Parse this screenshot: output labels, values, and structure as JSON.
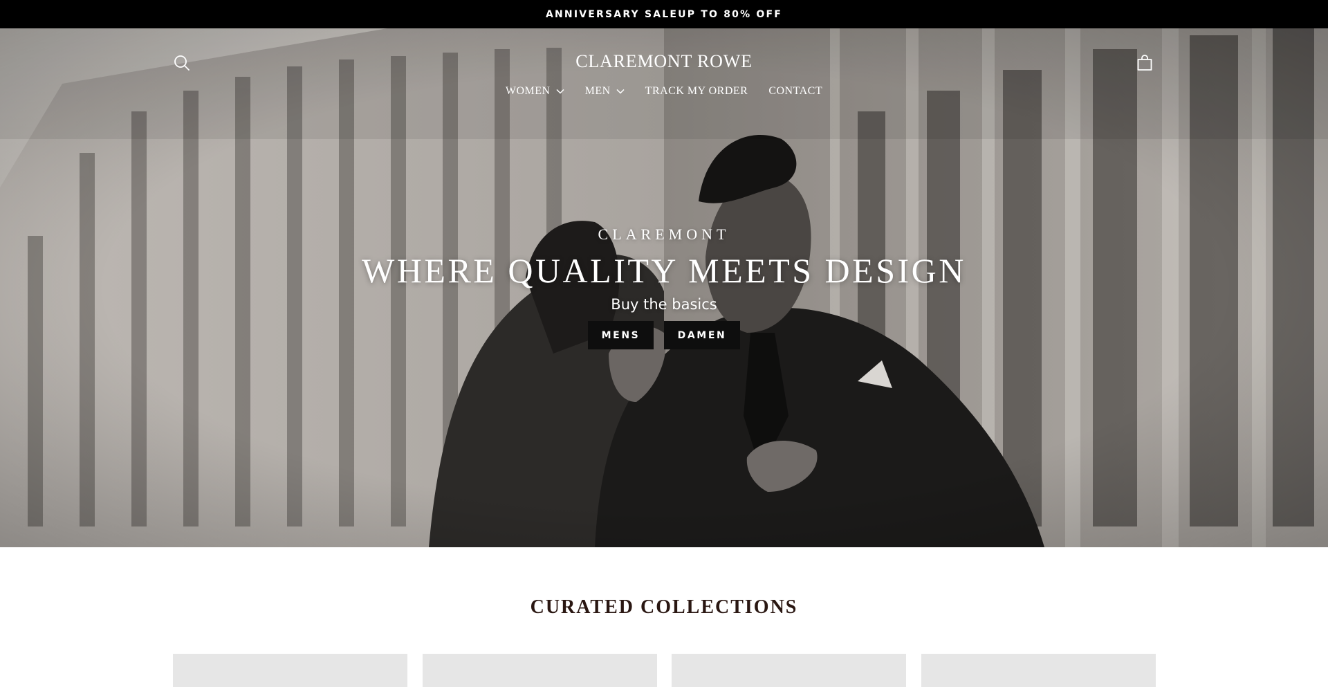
{
  "announcement": {
    "text": "ANNIVERSARY SALEUP TO 80% OFF"
  },
  "header": {
    "logo": "CLAREMONT ROWE",
    "search_icon": "search-icon",
    "cart_icon": "shopping-bag-icon",
    "nav": [
      {
        "label": "WOMEN",
        "has_dropdown": true,
        "icon": "chevron-down-icon"
      },
      {
        "label": "MEN",
        "has_dropdown": true,
        "icon": "chevron-down-icon"
      },
      {
        "label": "TRACK MY ORDER",
        "has_dropdown": false
      },
      {
        "label": "CONTACT",
        "has_dropdown": false
      }
    ]
  },
  "hero": {
    "kicker": "CLAREMONT",
    "headline": "WHERE QUALITY MEETS DESIGN",
    "subheading": "Buy the basics",
    "buttons": [
      {
        "label": "MENS"
      },
      {
        "label": "DAMEN"
      }
    ],
    "image_description": "black-and-white photo of a couple embracing in front of a building"
  },
  "collections": {
    "title": "CURATED COLLECTIONS",
    "card_count": 4
  },
  "colors": {
    "announcement_bg": "#000000",
    "button_bg": "#0e0e0e",
    "heading_text": "#2a1712",
    "card_placeholder": "#e6e6e6"
  }
}
